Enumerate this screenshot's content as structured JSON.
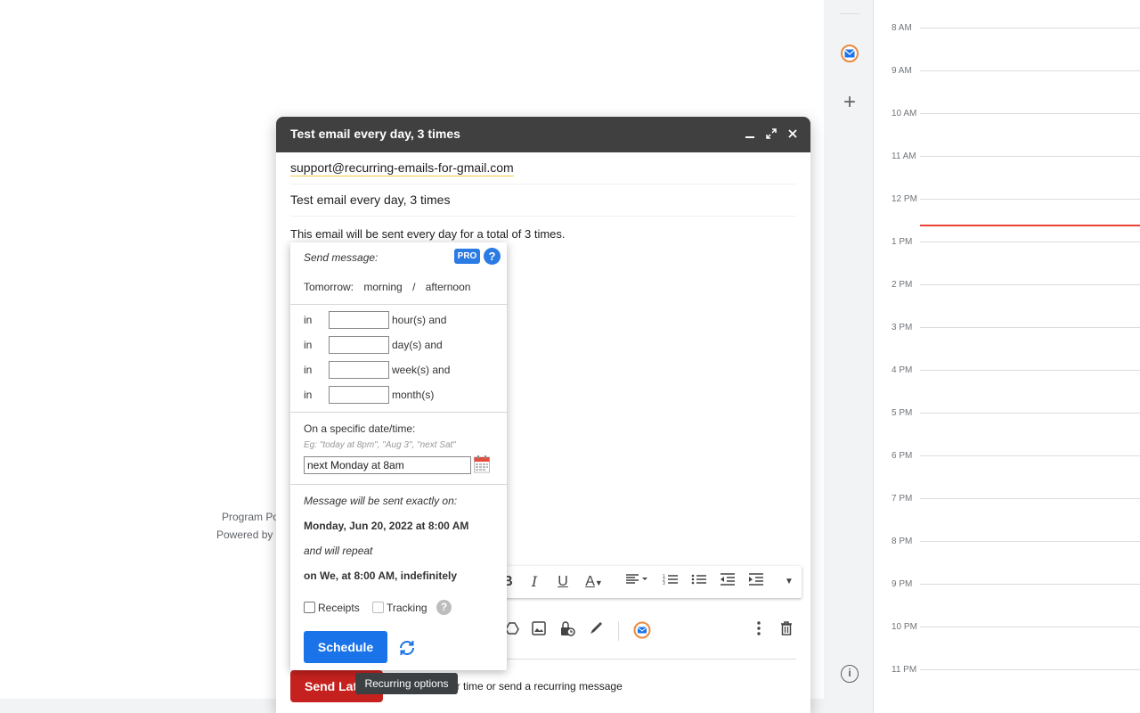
{
  "background": {
    "footer_line1": "Program Po",
    "footer_line2": "Powered by"
  },
  "calendar": {
    "hours": [
      "8 AM",
      "9 AM",
      "10 AM",
      "11 AM",
      "12 PM",
      "1 PM",
      "2 PM",
      "3 PM",
      "4 PM",
      "5 PM",
      "6 PM",
      "7 PM",
      "8 PM",
      "9 PM",
      "10 PM",
      "11 PM"
    ],
    "now_color": "#ea4335"
  },
  "compose": {
    "title": "Test email every day, 3 times",
    "to": "support@recurring-emails-for-gmail.com",
    "subject": "Test email every day, 3 times",
    "body": "This email will be sent every day for a total of 3 times.",
    "send_later_label": "Send Lat",
    "hint": "er time or send a recurring message"
  },
  "popup": {
    "send_message_label": "Send message:",
    "pro_badge": "PRO",
    "help": "?",
    "tomorrow_label": "Tomorrow:",
    "morning": "morning",
    "slash": "/",
    "afternoon": "afternoon",
    "in_label": "in",
    "hours_unit": "hour(s) and",
    "days_unit": "day(s) and",
    "weeks_unit": "week(s) and",
    "months_unit": "month(s)",
    "specific_label": "On a specific date/time:",
    "specific_hint": "Eg: \"today at 8pm\", \"Aug 3\", \"next Sat\"",
    "date_value": "next Monday at 8am",
    "sent_exactly_label": "Message will be sent exactly on:",
    "sent_date": "Monday, Jun 20, 2022 at 8:00 AM",
    "repeat_label": "and will repeat",
    "repeat_value": "on We, at 8:00 AM, indefinitely",
    "receipts": "Receipts",
    "tracking": "Tracking",
    "tracking_help": "?",
    "schedule": "Schedule"
  },
  "tooltip": "Recurring options",
  "colors": {
    "send_later": "#c5221f",
    "schedule": "#1a73e8",
    "pro": "#2a7be4"
  }
}
